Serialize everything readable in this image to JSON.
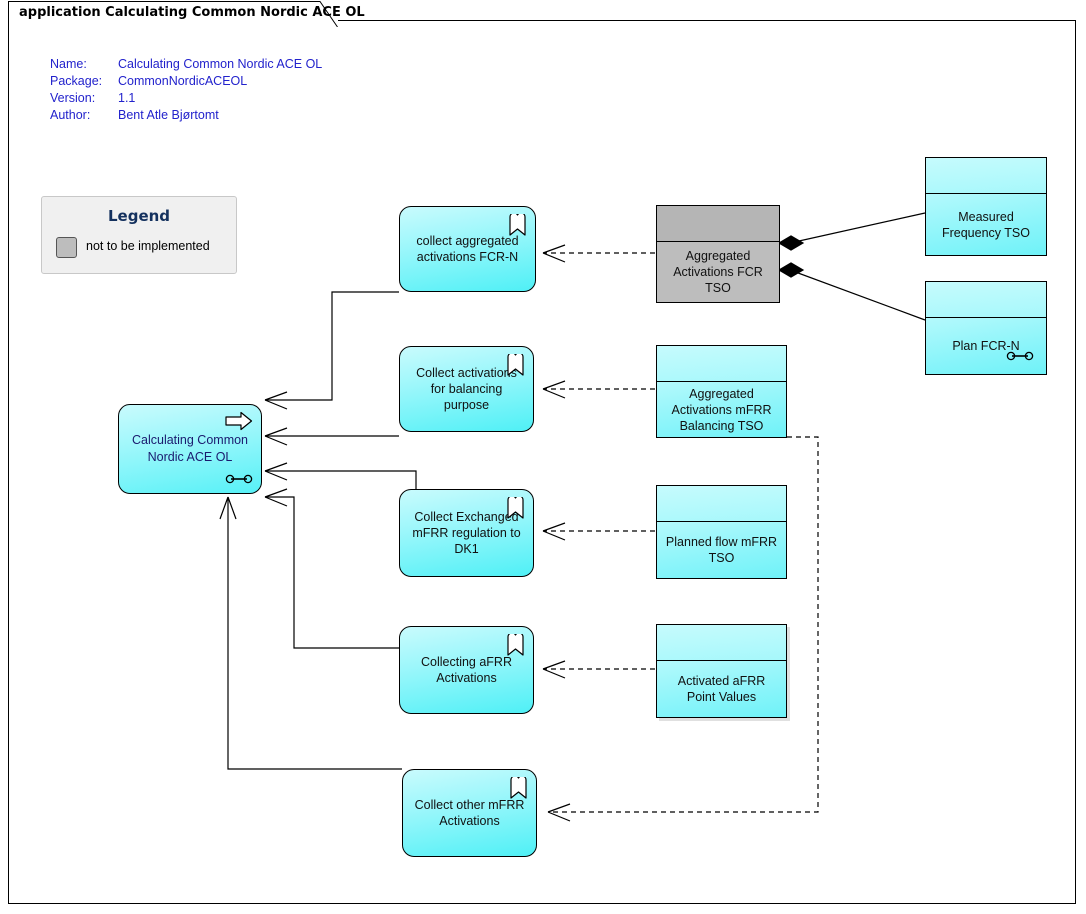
{
  "window": {
    "tab_label": "application Calculating Common Nordic ACE OL"
  },
  "meta": {
    "name_key": "Name:",
    "name_value": "Calculating Common Nordic ACE OL",
    "package_key": "Package:",
    "package_value": "CommonNordicACEOL",
    "version_key": "Version:",
    "version_value": "1.1",
    "author_key": "Author:",
    "author_value": "Bent Atle Bjørtomt"
  },
  "legend": {
    "title": "Legend",
    "swatch_color": "#bdbdbd",
    "item_label": "not to be implemented"
  },
  "colors": {
    "meta_text": "#2222cc",
    "legend_title": "#14315e",
    "cyan_fill": "#8df5fa",
    "cyan_light": "#c9fbfd",
    "gray_fill": "#bdbdbd",
    "gray_header": "#b5b5b5",
    "line": "#000000"
  },
  "nodes": {
    "application": {
      "label": "Calculating Common Nordic ACE OL",
      "type": "application-component",
      "icons": [
        "process-arrow-icon",
        "ball-and-socket-icon"
      ]
    },
    "usecases": [
      {
        "id": "uc-collect-aggregated-fcrn",
        "label": "collect aggregated activations FCR-N"
      },
      {
        "id": "uc-collect-balancing",
        "label": "Collect activations for balancing purpose"
      },
      {
        "id": "uc-collect-exchanged-mfrr-dk1",
        "label": "Collect Exchanged mFRR regulation to DK1"
      },
      {
        "id": "uc-collecting-afrr",
        "label": "Collecting aFRR Activations"
      },
      {
        "id": "uc-collect-other-mfrr",
        "label": "Collect other mFRR Activations"
      }
    ],
    "entities": [
      {
        "id": "ent-aggregated-fcr-tso",
        "label": "Aggregated Activations FCR TSO",
        "style": "gray"
      },
      {
        "id": "ent-measured-frequency-tso",
        "label": "Measured Frequency TSO",
        "style": "cyan"
      },
      {
        "id": "ent-plan-fcr-n",
        "label": "Plan FCR-N",
        "style": "cyan"
      },
      {
        "id": "ent-aggregated-mfrr-balancing-tso",
        "label": "Aggregated Activations mFRR Balancing TSO",
        "style": "cyan"
      },
      {
        "id": "ent-planned-flow-mfrr-tso",
        "label": "Planned flow mFRR TSO",
        "style": "cyan"
      },
      {
        "id": "ent-activated-afrr-point-values",
        "label": "Activated aFRR Point Values",
        "style": "cyan"
      }
    ]
  }
}
